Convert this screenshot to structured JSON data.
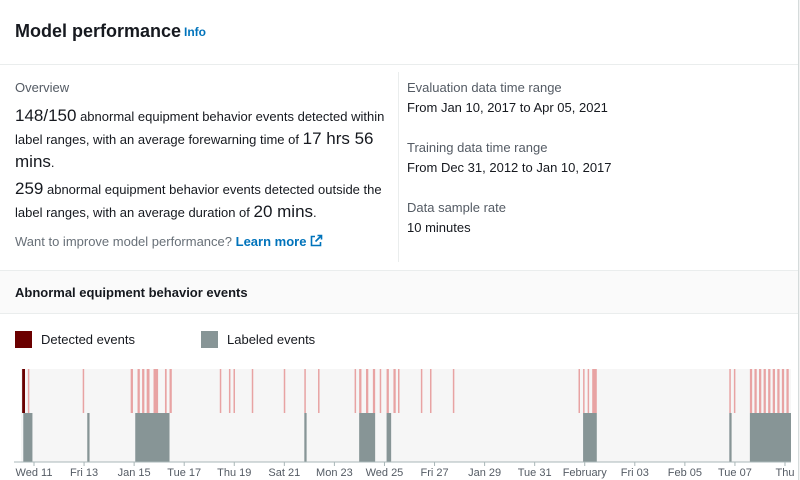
{
  "header": {
    "title": "Model performance",
    "info_link": "Info"
  },
  "overview": {
    "label": "Overview",
    "stat1": {
      "fraction": "148/150",
      "text1": " abnormal equipment behavior events detected within label ranges, with an average forewarning time of ",
      "value": "17 hrs 56 mins",
      "text2": "."
    },
    "stat2": {
      "count": "259",
      "text1": " abnormal equipment behavior events detected outside the label ranges, with an average duration of ",
      "value": "20 mins",
      "text2": "."
    },
    "improve_text": "Want to improve model performance? ",
    "learn_more": "Learn more"
  },
  "details": {
    "eval_label": "Evaluation data time range",
    "eval_value": "From Jan 10, 2017 to Apr 05, 2021",
    "train_label": "Training data time range",
    "train_value": "From Dec 31, 2012 to Jan 10, 2017",
    "rate_label": "Data sample rate",
    "rate_value": "10 minutes"
  },
  "events_section": {
    "title": "Abnormal equipment behavior events"
  },
  "legend": {
    "detected": {
      "label": "Detected events",
      "color": "#6b0000"
    },
    "labeled": {
      "label": "Labeled events",
      "color": "#879596"
    }
  },
  "chart_data": {
    "type": "timeline",
    "x_range": [
      "2017-01-10T22:00",
      "2017-02-08T00:00"
    ],
    "x_ticks": [
      "Wed 11",
      "Fri 13",
      "Jan 15",
      "Tue 17",
      "Thu 19",
      "Sat 21",
      "Mon 23",
      "Wed 25",
      "Fri 27",
      "Jan 29",
      "Tue 31",
      "February",
      "Fri 03",
      "Feb 05",
      "Tue 07",
      "Thu"
    ],
    "colors": {
      "detected": "#e8a3a3",
      "detected_dark": "#6b0000",
      "labeled": "#879596"
    },
    "labeled_events": [
      [
        "2017-01-11T00:00",
        "2017-01-11T08:00"
      ],
      [
        "2017-01-13T08:00",
        "2017-01-13T10:00"
      ],
      [
        "2017-01-15T02:00",
        "2017-01-16T08:00"
      ],
      [
        "2017-01-21T06:00",
        "2017-01-21T08:00"
      ],
      [
        "2017-01-23T06:00",
        "2017-01-23T20:00"
      ],
      [
        "2017-01-24T06:00",
        "2017-01-24T10:00"
      ],
      [
        "2017-01-31T10:00",
        "2017-01-31T22:00"
      ],
      [
        "2017-02-05T18:00",
        "2017-02-05T20:00"
      ],
      [
        "2017-02-06T12:00",
        "2017-02-08T00:00"
      ]
    ],
    "detected_events": [
      [
        "2017-01-10T23:00",
        "2017-01-11T01:30",
        "dark"
      ],
      [
        "2017-01-11T04:00",
        "2017-01-11T05:00"
      ],
      [
        "2017-01-13T04:00",
        "2017-01-13T05:00"
      ],
      [
        "2017-01-14T22:00",
        "2017-01-15T00:00"
      ],
      [
        "2017-01-15T04:00",
        "2017-01-15T06:00"
      ],
      [
        "2017-01-15T08:00",
        "2017-01-15T10:00"
      ],
      [
        "2017-01-15T12:00",
        "2017-01-15T14:30"
      ],
      [
        "2017-01-15T18:00",
        "2017-01-15T22:00"
      ],
      [
        "2017-01-16T04:00",
        "2017-01-16T05:30"
      ],
      [
        "2017-01-16T08:00",
        "2017-01-16T10:00"
      ],
      [
        "2017-01-18T04:00",
        "2017-01-18T05:00"
      ],
      [
        "2017-01-18T12:00",
        "2017-01-18T13:00"
      ],
      [
        "2017-01-18T16:00",
        "2017-01-18T17:00"
      ],
      [
        "2017-01-19T08:00",
        "2017-01-19T09:00"
      ],
      [
        "2017-01-20T12:00",
        "2017-01-20T13:00"
      ],
      [
        "2017-01-21T06:00",
        "2017-01-21T07:00"
      ],
      [
        "2017-01-21T18:00",
        "2017-01-21T19:00"
      ],
      [
        "2017-01-23T02:00",
        "2017-01-23T03:00"
      ],
      [
        "2017-01-23T06:00",
        "2017-01-23T08:00"
      ],
      [
        "2017-01-23T12:00",
        "2017-01-23T14:00"
      ],
      [
        "2017-01-23T18:00",
        "2017-01-23T20:00"
      ],
      [
        "2017-01-24T00:00",
        "2017-01-24T01:00"
      ],
      [
        "2017-01-24T06:00",
        "2017-01-24T08:00"
      ],
      [
        "2017-01-24T12:00",
        "2017-01-24T14:00"
      ],
      [
        "2017-01-24T16:00",
        "2017-01-24T17:00"
      ],
      [
        "2017-01-25T12:00",
        "2017-01-25T13:00"
      ],
      [
        "2017-01-25T20:00",
        "2017-01-25T21:00"
      ],
      [
        "2017-01-26T16:00",
        "2017-01-26T17:00"
      ],
      [
        "2017-01-31T06:00",
        "2017-01-31T07:00"
      ],
      [
        "2017-01-31T10:00",
        "2017-01-31T11:00"
      ],
      [
        "2017-01-31T14:00",
        "2017-01-31T15:00"
      ],
      [
        "2017-01-31T18:00",
        "2017-01-31T22:00"
      ],
      [
        "2017-02-05T18:00",
        "2017-02-05T19:00"
      ],
      [
        "2017-02-05T22:00",
        "2017-02-05T23:00"
      ],
      [
        "2017-02-06T12:00",
        "2017-02-06T14:00"
      ],
      [
        "2017-02-06T16:00",
        "2017-02-06T18:00"
      ],
      [
        "2017-02-06T20:00",
        "2017-02-06T22:00"
      ],
      [
        "2017-02-07T00:00",
        "2017-02-07T02:00"
      ],
      [
        "2017-02-07T04:00",
        "2017-02-07T06:00"
      ],
      [
        "2017-02-07T08:00",
        "2017-02-07T10:00"
      ],
      [
        "2017-02-07T12:00",
        "2017-02-07T14:00"
      ],
      [
        "2017-02-07T16:00",
        "2017-02-07T18:00"
      ],
      [
        "2017-02-07T20:00",
        "2017-02-07T22:00"
      ]
    ]
  }
}
